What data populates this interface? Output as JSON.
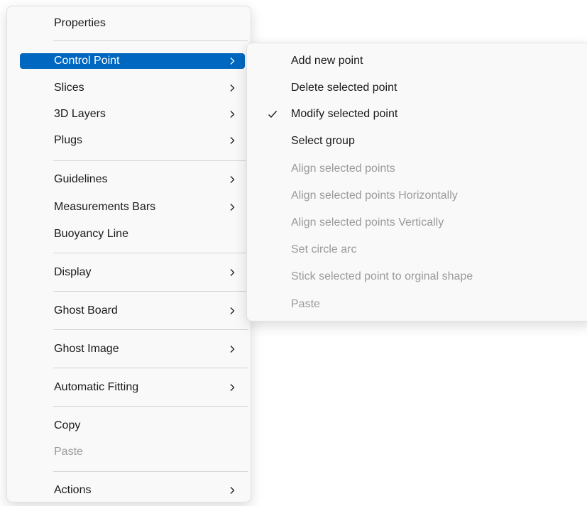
{
  "main_menu": {
    "items": [
      {
        "label": "Properties",
        "has_submenu": false,
        "disabled": false
      },
      {
        "label": "Control Point",
        "has_submenu": true,
        "disabled": false,
        "highlighted": true
      },
      {
        "label": "Slices",
        "has_submenu": true,
        "disabled": false
      },
      {
        "label": "3D Layers",
        "has_submenu": true,
        "disabled": false
      },
      {
        "label": "Plugs",
        "has_submenu": true,
        "disabled": false
      },
      {
        "label": "Guidelines",
        "has_submenu": true,
        "disabled": false
      },
      {
        "label": "Measurements Bars",
        "has_submenu": true,
        "disabled": false
      },
      {
        "label": "Buoyancy Line",
        "has_submenu": false,
        "disabled": false
      },
      {
        "label": "Display",
        "has_submenu": true,
        "disabled": false
      },
      {
        "label": "Ghost Board",
        "has_submenu": true,
        "disabled": false
      },
      {
        "label": "Ghost Image",
        "has_submenu": true,
        "disabled": false
      },
      {
        "label": "Automatic Fitting",
        "has_submenu": true,
        "disabled": false
      },
      {
        "label": "Copy",
        "has_submenu": false,
        "disabled": false
      },
      {
        "label": "Paste",
        "has_submenu": false,
        "disabled": true
      },
      {
        "label": "Actions",
        "has_submenu": true,
        "disabled": false
      }
    ]
  },
  "control_point_submenu": {
    "items": [
      {
        "label": "Add new point",
        "disabled": false,
        "checked": false
      },
      {
        "label": "Delete selected point",
        "disabled": false,
        "checked": false
      },
      {
        "label": "Modify selected point",
        "disabled": false,
        "checked": true
      },
      {
        "label": "Select group",
        "disabled": false,
        "checked": false
      },
      {
        "label": "Align selected points",
        "disabled": true,
        "checked": false
      },
      {
        "label": "Align selected points Horizontally",
        "disabled": true,
        "checked": false
      },
      {
        "label": "Align selected points Vertically",
        "disabled": true,
        "checked": false
      },
      {
        "label": "Set circle arc",
        "disabled": true,
        "checked": false
      },
      {
        "label": "Stick selected point to orginal shape",
        "disabled": true,
        "checked": false
      },
      {
        "label": "Paste",
        "disabled": true,
        "checked": false
      }
    ]
  },
  "icons": {
    "submenu_arrow": "chevron-right-icon",
    "checkmark": "checkmark-icon"
  },
  "colors": {
    "highlight": "#0067c0",
    "disabled_text": "#9a9a9a",
    "menu_background": "#f9f9f9"
  }
}
